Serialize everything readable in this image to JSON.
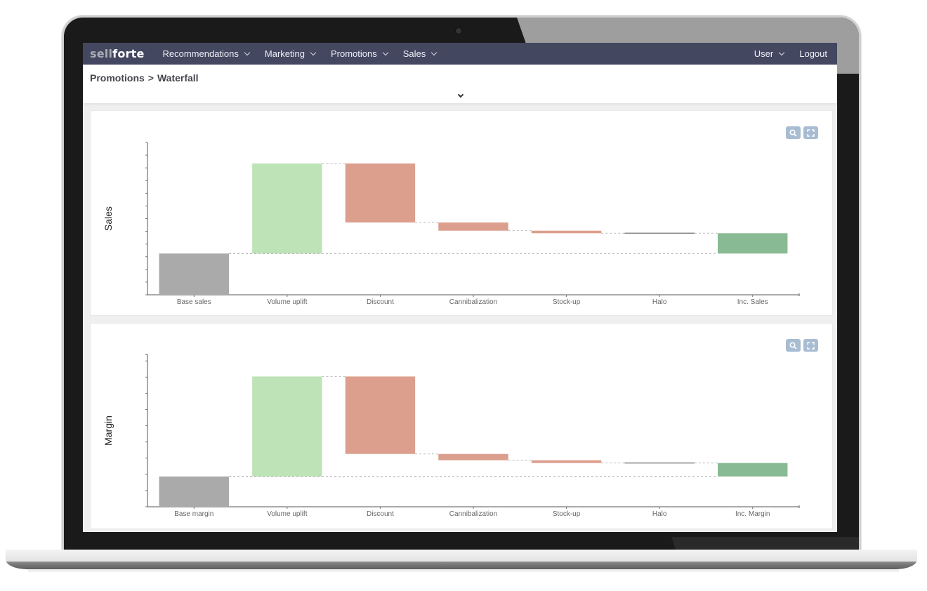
{
  "app": {
    "brand_part1": "sell",
    "brand_part2": "forte"
  },
  "nav": {
    "items": [
      {
        "label": "Recommendations"
      },
      {
        "label": "Marketing"
      },
      {
        "label": "Promotions"
      },
      {
        "label": "Sales"
      }
    ],
    "user_label": "User",
    "logout_label": "Logout"
  },
  "breadcrumb": {
    "section": "Promotions",
    "separator": ">",
    "page": "Waterfall"
  },
  "icons": {
    "zoom": "zoom-icon",
    "fullscreen": "fullscreen-icon",
    "chevron": "chevron-down-icon"
  },
  "colors": {
    "navbar": "#434760",
    "base": "#aaaaaa",
    "increase": "#bde3b7",
    "decrease": "#dc9f8d",
    "total": "#88bb93",
    "halo": "#888888",
    "tool_button": "#a8bcd2"
  },
  "chart_data": [
    {
      "type": "waterfall",
      "title": "",
      "ylabel": "Sales",
      "xlabel": "",
      "ylim": [
        0,
        12
      ],
      "yticks": [
        0,
        1,
        2,
        3,
        4,
        5,
        6,
        7,
        8,
        9,
        10,
        11,
        12
      ],
      "ytick_labels_visible": false,
      "grid": false,
      "categories": [
        "Base sales",
        "Volume uplift",
        "Discount",
        "Cannibalization",
        "Stock-up",
        "Halo",
        "Inc. Sales"
      ],
      "values": [
        3.25,
        7.1,
        -4.65,
        -0.65,
        -0.2,
        0.0,
        1.6
      ],
      "kinds": [
        "base",
        "increase",
        "decrease",
        "decrease",
        "decrease",
        "halo",
        "total"
      ]
    },
    {
      "type": "waterfall",
      "title": "",
      "ylabel": "Margin",
      "xlabel": "",
      "ylim": [
        0,
        9.4
      ],
      "yticks": [
        0,
        1,
        2,
        3,
        4,
        5,
        6,
        7,
        8,
        9
      ],
      "ytick_labels_visible": false,
      "grid": false,
      "categories": [
        "Base margin",
        "Volume uplift",
        "Discount",
        "Cannibalization",
        "Stock-up",
        "Halo",
        "Inc. Margin"
      ],
      "values": [
        1.87,
        6.17,
        -4.78,
        -0.39,
        -0.17,
        0.0,
        0.83
      ],
      "kinds": [
        "base",
        "increase",
        "decrease",
        "decrease",
        "decrease",
        "halo",
        "total"
      ]
    }
  ]
}
